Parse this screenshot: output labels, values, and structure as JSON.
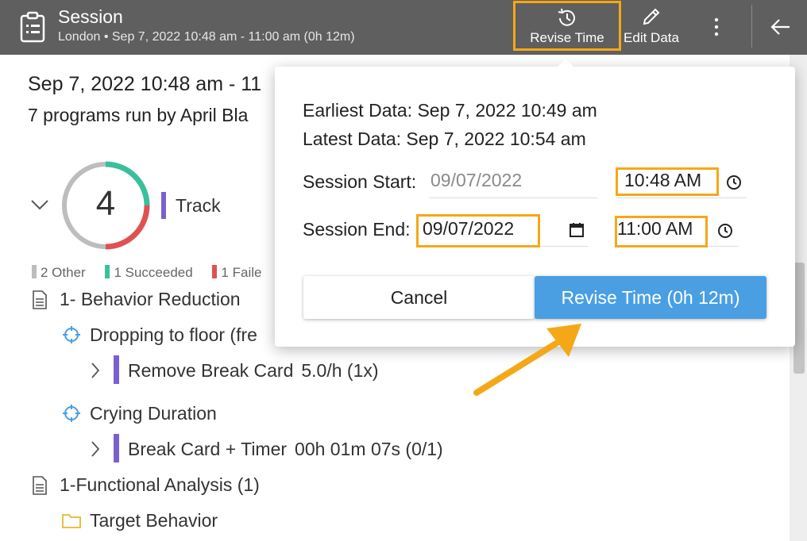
{
  "header": {
    "title": "Session",
    "subtitle": "London • Sep 7, 2022 10:48 am - 11:00 am (0h 12m)",
    "revise_time_label": "Revise Time",
    "edit_data_label": "Edit Data"
  },
  "session": {
    "date_heading": "Sep 7, 2022 10:48 am - 11",
    "programs_line": "7 programs run by April Bla",
    "summary_count": "4",
    "track_label": "Track",
    "legend": [
      {
        "label": "2 Other",
        "color": "#bdbdbd"
      },
      {
        "label": "1 Succeeded",
        "color": "#3bbf9c"
      },
      {
        "label": "1 Faile",
        "color": "#e05252"
      }
    ],
    "programs": [
      {
        "title": "1- Behavior Reduction"
      },
      {
        "target": "Dropping to floor (fre",
        "sub": "Remove Break Card",
        "value": "5.0/h (1x)"
      },
      {
        "target": "Crying Duration",
        "sub": "Break Card + Timer",
        "value": "00h 01m 07s (0/1)"
      },
      {
        "title": "1-Functional Analysis (1)"
      },
      {
        "folder": "Target Behavior"
      }
    ]
  },
  "popup": {
    "earliest": "Earliest Data: Sep 7, 2022 10:49 am",
    "latest": "Latest Data: Sep 7, 2022 10:54 am",
    "start_label": "Session Start:",
    "start_date": "09/07/2022",
    "start_time": "10:48  AM",
    "end_label": "Session End:",
    "end_date": "09/07/2022",
    "end_time": "11:00  AM",
    "cancel_label": "Cancel",
    "confirm_label": "Revise Time (0h 12m)"
  },
  "colors": {
    "header_bg": "#5f5f5f",
    "highlight": "#f5a817",
    "primary": "#4a9fe3",
    "track": "#7b5fd1"
  }
}
